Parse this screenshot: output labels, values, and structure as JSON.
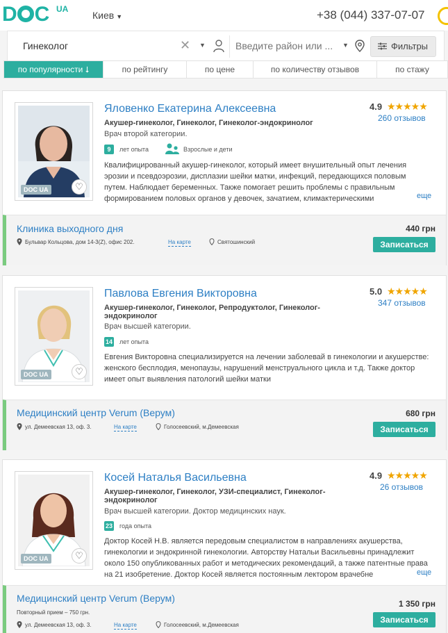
{
  "header": {
    "logo_text": "DOC",
    "logo_sup": "UA",
    "city": "Киев",
    "phone": "+38 (044) 337-07-07"
  },
  "search": {
    "query": "Гинеколог",
    "district_placeholder": "Введите район или ...",
    "filters_label": "Фильтры"
  },
  "sort_tabs": [
    {
      "label": "по популярности",
      "active": true
    },
    {
      "label": "по рейтингу"
    },
    {
      "label": "по цене"
    },
    {
      "label": "по количеству отзывов"
    },
    {
      "label": "по стажу"
    }
  ],
  "doctors": [
    {
      "name": "Яловенко Екатерина Алексеевна",
      "rating": "4.9",
      "stars": "★★★★★",
      "reviews": "260 отзывов",
      "specialties": "Акушер-гинеколог, Гинеколог, Гинеколог-эндокринолог",
      "category": "Врач второй категории.",
      "experience_years": "9",
      "experience_label": "лет опыта",
      "ages": "Взрослые и дети",
      "description": "Квалифицированный акушер-гинеколог, который имеет внушительный опыт лечения эрозии и псевдоэрозии, дисплазии шейки матки, инфекций, передающихся половым путем. Наблюдает беременных. Также помогает решить проблемы с правильным формированием половых органов у девочек, зачатием, климактерическими",
      "more": "еще",
      "clinic": {
        "name": "Клиника выходного дня",
        "address": "Бульвар Кольцова, дом 14-3(Z), офис 202.",
        "map_link": "На карте",
        "district": "Святошинский",
        "price": "440 грн",
        "book": "Записаться"
      }
    },
    {
      "name": "Павлова Евгения Викторовна",
      "rating": "5.0",
      "stars": "★★★★★",
      "reviews": "347 отзывов",
      "specialties": "Акушер-гинеколог, Гинеколог, Репродуктолог, Гинеколог-эндокринолог",
      "category": "Врач высшей категории.",
      "experience_years": "14",
      "experience_label": "лет опыта",
      "description": "Евгения Викторовна специализируется на лечении заболевай в гинекологии и акушерстве: женского бесплодия, менопаузы, нарушений менструального цикла и т.д. Также доктор имеет опыт выявления патологий шейки матки",
      "clinic": {
        "name": "Медицинский центр Verum (Верум)",
        "address": "ул. Демеевская 13, оф. 3.",
        "map_link": "На карте",
        "district": "Голосеевский, м.Демеевская",
        "price": "680 грн",
        "book": "Записаться"
      }
    },
    {
      "name": "Косей Наталья Васильевна",
      "rating": "4.9",
      "stars": "★★★★★",
      "reviews": "26 отзывов",
      "specialties": "Акушер-гинеколог, Гинеколог, УЗИ-специалист, Гинеколог-эндокринолог",
      "category": "Врач высшей категории. Доктор медицинских наук.",
      "experience_years": "23",
      "experience_label": "года опыта",
      "description": "Доктор Косей Н.В. является передовым специалистом в направлениях акушерства, гинекологии и эндокринной гинекологии. Авторству Натальи Васильевны принадлежит около 150 опубликованных работ и методических рекомендаций, а также патентные права на 21 изобретение. Доктор Косей является постоянным лектором врачебне",
      "more": "еще",
      "clinic": {
        "name": "Медицинский центр Verum (Верум)",
        "extra": "Повторный прием – 750 грн.",
        "address": "ул. Демеевская 13, оф. 3.",
        "map_link": "На карте",
        "district": "Голосеевский, м.Демеевская",
        "price": "1 350 грн",
        "book": "Записаться"
      }
    }
  ],
  "photo_badge": "DOC UA",
  "colors": {
    "accent": "#2dae9f",
    "link": "#2d7fc4",
    "stars": "#f0a500",
    "clinic_stripe": "#7acb7f"
  }
}
